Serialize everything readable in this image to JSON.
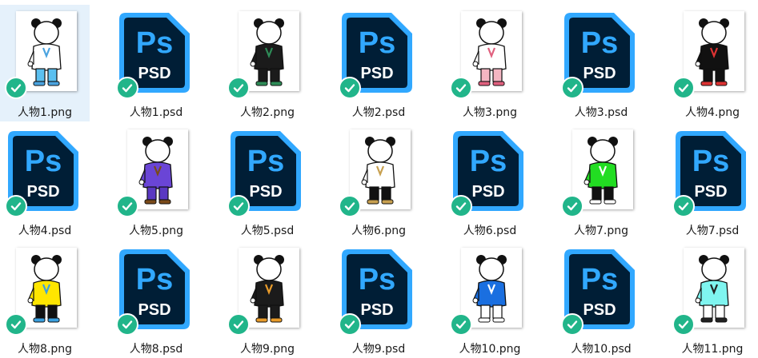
{
  "colors": {
    "selection": "#e5f1fb",
    "ps_frame": "#31a8ff",
    "ps_body": "#001e36",
    "sync_check": "#21b58a"
  },
  "files": [
    {
      "name": "人物1.png",
      "type": "png",
      "outfit": "#ffffff",
      "pants": "#5bc0f0",
      "accent": "#4aa3df",
      "selected": true
    },
    {
      "name": "人物1.psd",
      "type": "psd",
      "badge": "PSD",
      "logo": "Ps"
    },
    {
      "name": "人物2.png",
      "type": "png",
      "outfit": "#1b1b1b",
      "pants": "#1b1b1b",
      "accent": "#2e8b57"
    },
    {
      "name": "人物2.psd",
      "type": "psd",
      "badge": "PSD",
      "logo": "Ps"
    },
    {
      "name": "人物3.png",
      "type": "png",
      "outfit": "#ffffff",
      "pants": "#f4b6c2",
      "accent": "#e0607e"
    },
    {
      "name": "人物3.psd",
      "type": "psd",
      "badge": "PSD",
      "logo": "Ps"
    },
    {
      "name": "人物4.png",
      "type": "png",
      "outfit": "#111111",
      "pants": "#111111",
      "accent": "#d33"
    },
    {
      "name": "人物4.psd",
      "type": "psd",
      "badge": "PSD",
      "logo": "Ps"
    },
    {
      "name": "人物5.png",
      "type": "png",
      "outfit": "#6a45d6",
      "pants": "#5a38c2",
      "accent": "#7a4a1a"
    },
    {
      "name": "人物5.psd",
      "type": "psd",
      "badge": "PSD",
      "logo": "Ps"
    },
    {
      "name": "人物6.png",
      "type": "png",
      "outfit": "#ffffff",
      "pants": "#111111",
      "accent": "#c8a050"
    },
    {
      "name": "人物6.psd",
      "type": "psd",
      "badge": "PSD",
      "logo": "Ps"
    },
    {
      "name": "人物7.png",
      "type": "png",
      "outfit": "#22dd22",
      "pants": "#111111",
      "accent": "#ffffff"
    },
    {
      "name": "人物7.psd",
      "type": "psd",
      "badge": "PSD",
      "logo": "Ps"
    },
    {
      "name": "人物8.png",
      "type": "png",
      "outfit": "#ffe600",
      "pants": "#111111",
      "accent": "#3aa0e0"
    },
    {
      "name": "人物8.psd",
      "type": "psd",
      "badge": "PSD",
      "logo": "Ps"
    },
    {
      "name": "人物9.png",
      "type": "png",
      "outfit": "#1b1b1b",
      "pants": "#1b1b1b",
      "accent": "#e89b2a"
    },
    {
      "name": "人物9.psd",
      "type": "psd",
      "badge": "PSD",
      "logo": "Ps"
    },
    {
      "name": "人物10.png",
      "type": "png",
      "outfit": "#1a6fe0",
      "pants": "#ffffff",
      "accent": "#ffffff"
    },
    {
      "name": "人物10.psd",
      "type": "psd",
      "badge": "PSD",
      "logo": "Ps"
    },
    {
      "name": "人物11.png",
      "type": "png",
      "outfit": "#7ff5f0",
      "pants": "#ffffff",
      "accent": "#222222"
    }
  ]
}
